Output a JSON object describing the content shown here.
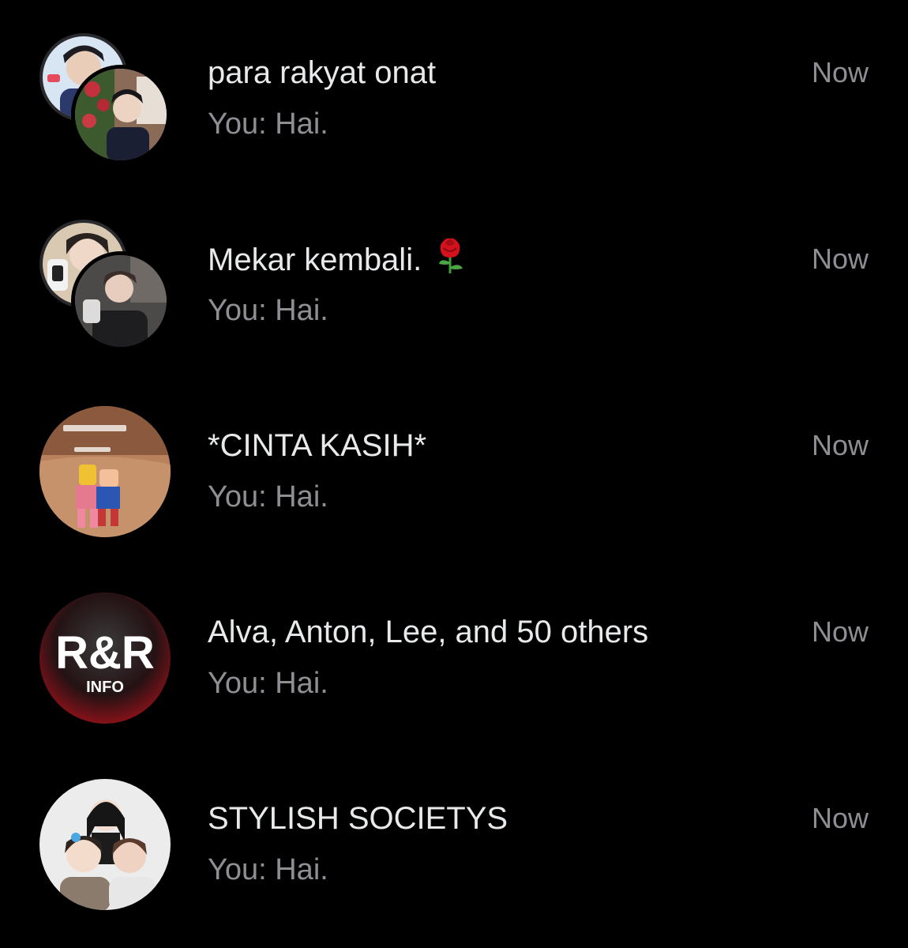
{
  "conversations": [
    {
      "title": "para rakyat onat",
      "preview": "You: Hai.",
      "time": "Now",
      "avatar": "group-photo-avatar"
    },
    {
      "title": "Mekar kembali.",
      "title_emoji": "rose-emoji",
      "preview": "You: Hai.",
      "time": "Now",
      "avatar": "group-photo-avatar"
    },
    {
      "title": "*CINTA KASIH*",
      "preview": "You: Hai.",
      "time": "Now",
      "avatar": "game-screenshot-avatar"
    },
    {
      "title": "Alva, Anton, Lee, and 50 others",
      "preview": "You: Hai.",
      "time": "Now",
      "avatar": "logo-avatar",
      "avatar_logo_text": "R&R",
      "avatar_logo_subtext": "INFO"
    },
    {
      "title": "STYLISH SOCIETYS",
      "preview": "You: Hai.",
      "time": "Now",
      "avatar": "group-photo-avatar"
    }
  ],
  "colors": {
    "background": "#000000",
    "title": "#e7e9ea",
    "secondary": "#8e8e93",
    "logo_red": "#b3121b"
  }
}
